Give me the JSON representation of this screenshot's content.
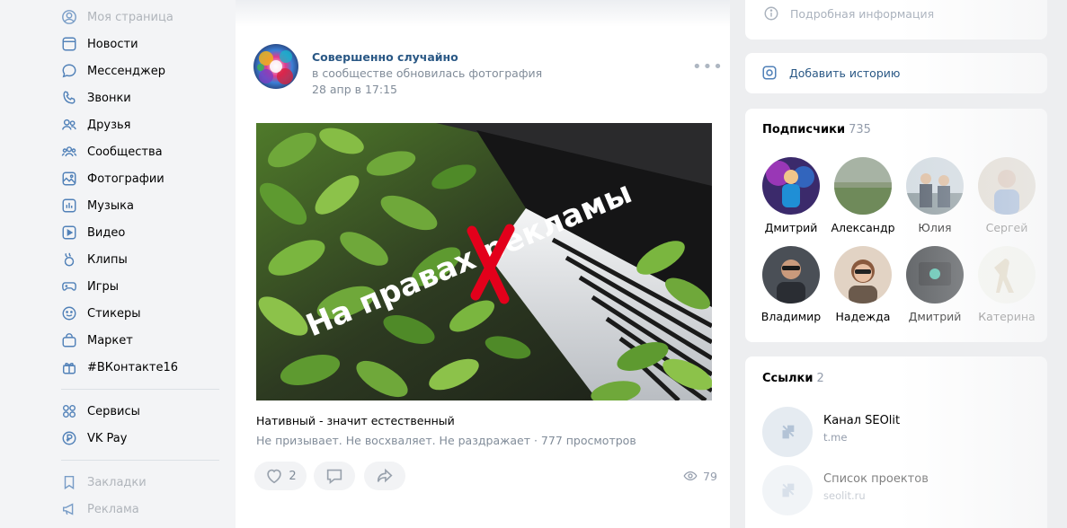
{
  "sidebar": {
    "items": [
      {
        "label": "Моя страница",
        "icon": "user-circle-icon"
      },
      {
        "label": "Новости",
        "icon": "newspaper-icon"
      },
      {
        "label": "Мессенджер",
        "icon": "chat-bubble-icon"
      },
      {
        "label": "Звонки",
        "icon": "phone-icon"
      },
      {
        "label": "Друзья",
        "icon": "friends-icon"
      },
      {
        "label": "Сообщества",
        "icon": "communities-icon"
      },
      {
        "label": "Фотографии",
        "icon": "photo-icon"
      },
      {
        "label": "Музыка",
        "icon": "music-icon"
      },
      {
        "label": "Видео",
        "icon": "video-icon"
      },
      {
        "label": "Клипы",
        "icon": "clips-icon"
      },
      {
        "label": "Игры",
        "icon": "gamepad-icon"
      },
      {
        "label": "Стикеры",
        "icon": "smile-icon"
      },
      {
        "label": "Маркет",
        "icon": "shopping-bag-icon"
      },
      {
        "label": "#ВКонтакте16",
        "icon": "gift-icon"
      }
    ],
    "services": [
      {
        "label": "Сервисы",
        "icon": "grid-icon"
      },
      {
        "label": "VK Pay",
        "icon": "vk-pay-icon"
      }
    ],
    "extra": [
      {
        "label": "Закладки",
        "icon": "bookmark-icon"
      },
      {
        "label": "Реклама",
        "icon": "megaphone-icon"
      }
    ]
  },
  "post": {
    "author": "Совершенно случайно",
    "subtitle": "в сообществе обновилась фотография",
    "time": "28 апр в 17:15",
    "image_overlay_text": "На правах рекламы",
    "text": "Нативный - значит естественный",
    "description": "Не призывает. Не восхваляет. Не раздражает · 777 просмотров",
    "likes": "2",
    "views": "79"
  },
  "right": {
    "info_label": "Подробная информация",
    "story_label": "Добавить историю",
    "subscribers": {
      "title": "Подписчики",
      "count": "735",
      "people": [
        {
          "name": "Дмитрий"
        },
        {
          "name": "Александр"
        },
        {
          "name": "Юлия"
        },
        {
          "name": "Сергей"
        },
        {
          "name": "Владимир"
        },
        {
          "name": "Надежда"
        },
        {
          "name": "Дмитрий"
        },
        {
          "name": "Катерина"
        }
      ]
    },
    "links": {
      "title": "Ссылки",
      "count": "2",
      "items": [
        {
          "title": "Канал SEOlit",
          "url": "t.me"
        },
        {
          "title": "Список проектов",
          "url": "seolit.ru"
        }
      ]
    }
  },
  "colors": {
    "accent": "#2a5885",
    "nav_icon": "#5181b8",
    "secondary_text": "#818c99",
    "background": "#edeef0",
    "overlay_x": "#e3001b"
  }
}
